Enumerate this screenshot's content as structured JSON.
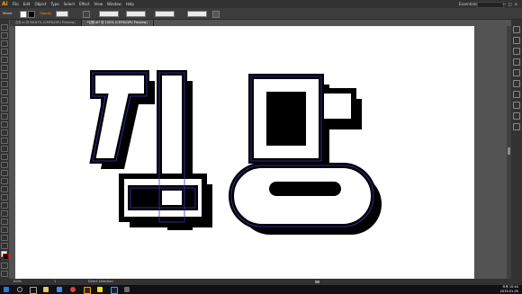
{
  "app": {
    "logo": "Ai",
    "accent": "#ff9a00"
  },
  "menu": [
    "File",
    "Edit",
    "Object",
    "Type",
    "Select",
    "Effect",
    "View",
    "Window",
    "Help"
  ],
  "workspace": "Essentials",
  "control_bar": {
    "selection": "Mixed",
    "opacity_label": "Opacity",
    "stroke_value": "",
    "fields": [
      "",
      "",
      ""
    ]
  },
  "tabs": [
    {
      "label": "김망.ai @ 66.67% (CMYK/GPU Preview)",
      "active": false
    },
    {
      "label": "*김왕.ai* @ 100% (CMYK/GPU Preview)",
      "active": true
    }
  ],
  "artwork": {
    "text": "김망",
    "stroke_color": "#000000",
    "fill_color": "#ffffff",
    "guide_color": "#3b39b8"
  },
  "status": {
    "zoom": "100%",
    "page": "1",
    "tool": "Direct Selection"
  },
  "taskbar": {
    "time": "오후 10:44",
    "date": "2019-01-05",
    "icons": [
      "start",
      "search",
      "task-view",
      "explorer",
      "store",
      "chrome",
      "illustrator",
      "kakaotalk",
      "photoshop",
      "media"
    ]
  }
}
